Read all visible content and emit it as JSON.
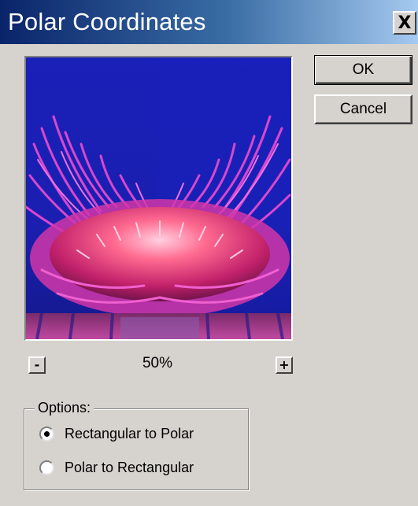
{
  "window": {
    "title": "Polar Coordinates",
    "close_glyph": "X"
  },
  "buttons": {
    "ok_label": "OK",
    "cancel_label": "Cancel"
  },
  "zoom": {
    "level": "50%",
    "minus_glyph": "-",
    "plus_glyph": "+"
  },
  "options": {
    "group_label": "Options:",
    "items": [
      {
        "label": "Rectangular to Polar",
        "selected": true
      },
      {
        "label": "Polar to Rectangular",
        "selected": false
      }
    ]
  },
  "preview": {
    "description_icon": "polar-distorted-flower-image",
    "colors": {
      "background": "#1a1fb0",
      "petal": "#e040c8",
      "center": "#ff5a7a"
    }
  }
}
